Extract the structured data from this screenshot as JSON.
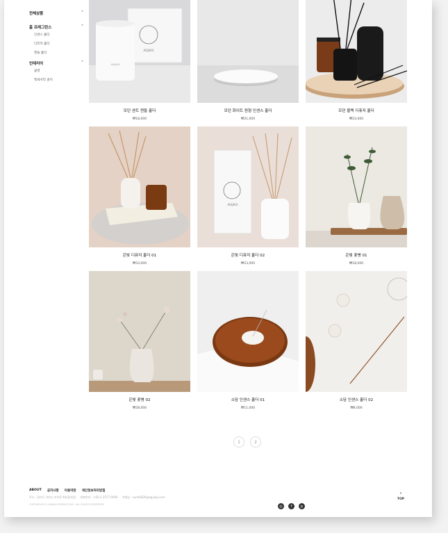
{
  "sidebar": {
    "groups": [
      {
        "label": "전체상품",
        "items": []
      },
      {
        "label": "홈 프래그런스",
        "items": [
          "인센스 홀더",
          "디퓨저 홀더",
          "캔들 홀더"
        ]
      },
      {
        "label": "인테리어",
        "items": [
          "꽃병",
          "액세서리 걸이"
        ]
      }
    ]
  },
  "products": [
    {
      "name": "모던 센트 캔들 홀더",
      "price": "₩18,000"
    },
    {
      "name": "모던 화이트 원형 인센스 홀더",
      "price": "₩21,000"
    },
    {
      "name": "모던 블랙 디퓨저 홀더",
      "price": "₩23,000"
    },
    {
      "name": "은빛 디퓨저 홀더 01",
      "price": "₩33,000"
    },
    {
      "name": "은빛 디퓨저 홀더 02",
      "price": "₩23,000"
    },
    {
      "name": "은빛 꽃병 01",
      "price": "₩18,000"
    },
    {
      "name": "은빛 꽃병 02",
      "price": "₩28,000"
    },
    {
      "name": "소담 인센스 홀더 01",
      "price": "₩11,000"
    },
    {
      "name": "소담 인센스 홀더 02",
      "price": "₩8,000"
    }
  ],
  "brand_text": "AGIJAGI",
  "pagination": {
    "pages": [
      "1",
      "2"
    ]
  },
  "footer": {
    "links": [
      "ABOUT",
      "공지사항",
      "이용약관",
      "개인정보처리방침"
    ],
    "address": "주소 : 경기도 이천시 부악로 40(중리동)",
    "phone": "대표번호 : +82-2-1577-0000",
    "email": "이메일 : sumi6826@agijagi.com",
    "copyright": "COPYRIGHT(C) AGIJAGI SERVICE INC. ALL RIGHTS RESERVED"
  },
  "top_label": "TOP",
  "icons": {
    "caret": "chevron-up-icon",
    "social": [
      "instagram-icon",
      "facebook-icon",
      "pinterest-icon"
    ]
  }
}
